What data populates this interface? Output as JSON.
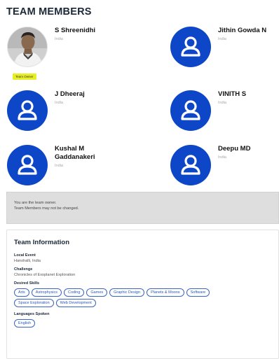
{
  "header": {
    "title": "TEAM MEMBERS"
  },
  "members": [
    {
      "name": "S Shreenidhi",
      "location": "India",
      "badge": "Team Owner"
    },
    {
      "name": "Jithin Gowda N",
      "location": "India"
    },
    {
      "name": "J Dheeraj",
      "location": "India"
    },
    {
      "name": "VINITH S",
      "location": "India"
    },
    {
      "name": "Kushal M Gaddanakeri",
      "location": "India"
    },
    {
      "name": "Deepu MD",
      "location": "India"
    }
  ],
  "notice": {
    "line1": "You are the team owner.",
    "line2": "Team Members may not be changed."
  },
  "team_info": {
    "title": "Team Information",
    "local_event_label": "Local Event",
    "local_event_value": "Hanohalli, India",
    "challenge_label": "Challenge",
    "challenge_value": "Chronicles of Exoplanet Exploration",
    "skills_label": "Desired Skills",
    "skills": [
      "Arts",
      "Astrophysics",
      "Coding",
      "Games",
      "Graphic Design",
      "Planets & Moons",
      "Software",
      "Space Exploration",
      "Web Development"
    ],
    "languages_label": "Languages Spoken",
    "languages": [
      "English"
    ]
  },
  "colors": {
    "avatar_blue": "#0d47c7",
    "badge_yellow": "#e8ee25",
    "chip_blue": "#2a57b8"
  },
  "icons": {
    "default_avatar": "person-icon"
  }
}
